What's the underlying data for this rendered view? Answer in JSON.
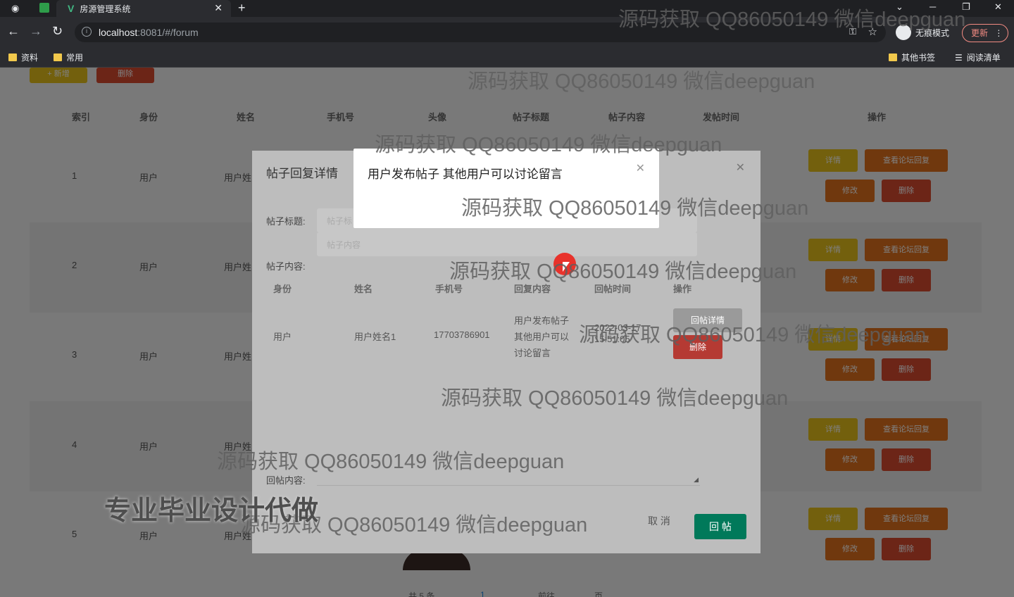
{
  "browser": {
    "tab_title": "房源管理系统",
    "url_host": "localhost",
    "url_rest": ":8081/#/forum",
    "incognito_label": "无痕模式",
    "update_label": "更新",
    "bookmarks": [
      "资料",
      "常用"
    ],
    "bookmarks_right": [
      "其他书签",
      "阅读清单"
    ]
  },
  "toolbar": {
    "add_label": "+ 新增",
    "delete_label": "删除"
  },
  "table": {
    "headers": [
      "索引",
      "身份",
      "姓名",
      "手机号",
      "头像",
      "帖子标题",
      "帖子内容",
      "发帖时间",
      "操作"
    ],
    "rows": [
      {
        "index": "1",
        "role": "用户",
        "name": "用户姓"
      },
      {
        "index": "2",
        "role": "用户",
        "name": "用户姓"
      },
      {
        "index": "3",
        "role": "用户",
        "name": "用户姓"
      },
      {
        "index": "4",
        "role": "用户",
        "name": "用户姓"
      },
      {
        "index": "5",
        "role": "用户",
        "name": "用户姓"
      }
    ],
    "actions": {
      "detail": "详情",
      "view_replies": "查看论坛回复",
      "edit": "修改",
      "delete": "删除"
    }
  },
  "pagination": {
    "total_prefix": "共 5 条",
    "page": "1",
    "goto": "前往",
    "page_unit": "页"
  },
  "dialog": {
    "title": "帖子回复详情",
    "post_title_label": "帖子标题:",
    "post_title_placeholder": "帖子标",
    "post_content_placeholder": "帖子内容",
    "post_content_label": "帖子内容:",
    "reply_headers": [
      "身份",
      "姓名",
      "手机号",
      "回复内容",
      "回帖时间",
      "操作"
    ],
    "reply_row": {
      "role": "用户",
      "name": "用户姓名1",
      "phone": "17703786901",
      "content_lines": [
        "用户发布帖子",
        "其他用户可以",
        "讨论留言"
      ],
      "time": "2022-03-17 15:51:05",
      "detail_btn": "回帖详情",
      "delete_btn": "删除"
    },
    "reply_label": "回帖内容:",
    "cancel_label": "取 消",
    "submit_label": "回 帖"
  },
  "message": {
    "text": "用户发布帖子 其他用户可以讨论留言"
  },
  "watermarks": {
    "main": "源码获取 QQ86050149 微信deepguan",
    "promo": "专业毕业设计代做"
  }
}
